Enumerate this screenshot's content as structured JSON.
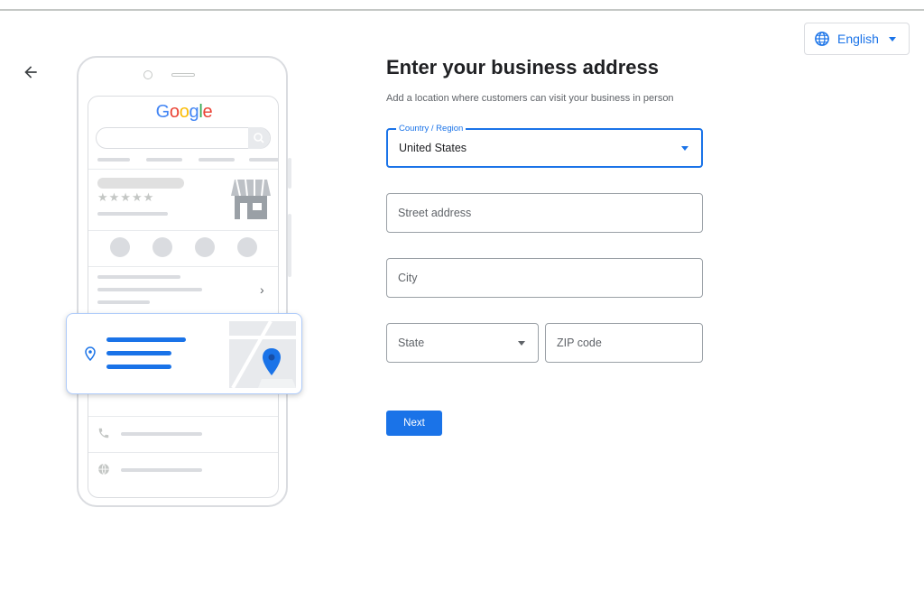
{
  "header": {
    "language_label": "English"
  },
  "illustration": {
    "google_letters": [
      {
        "ch": "G",
        "color": "#4285F4"
      },
      {
        "ch": "o",
        "color": "#EA4335"
      },
      {
        "ch": "o",
        "color": "#FBBC05"
      },
      {
        "ch": "g",
        "color": "#4285F4"
      },
      {
        "ch": "l",
        "color": "#34A853"
      },
      {
        "ch": "e",
        "color": "#EA4335"
      }
    ],
    "stars": "★★★★★",
    "chevron": "›"
  },
  "form": {
    "title": "Enter your business address",
    "subtitle": "Add a location where customers can visit your business in person",
    "country": {
      "label": "Country / Region",
      "value": "United States"
    },
    "street": {
      "placeholder": "Street address"
    },
    "city": {
      "placeholder": "City"
    },
    "state": {
      "placeholder": "State"
    },
    "zip": {
      "placeholder": "ZIP code"
    },
    "next_label": "Next"
  },
  "colors": {
    "accent": "#1a73e8",
    "border": "#9aa0a6",
    "text": "#202124",
    "muted": "#5f6368"
  }
}
